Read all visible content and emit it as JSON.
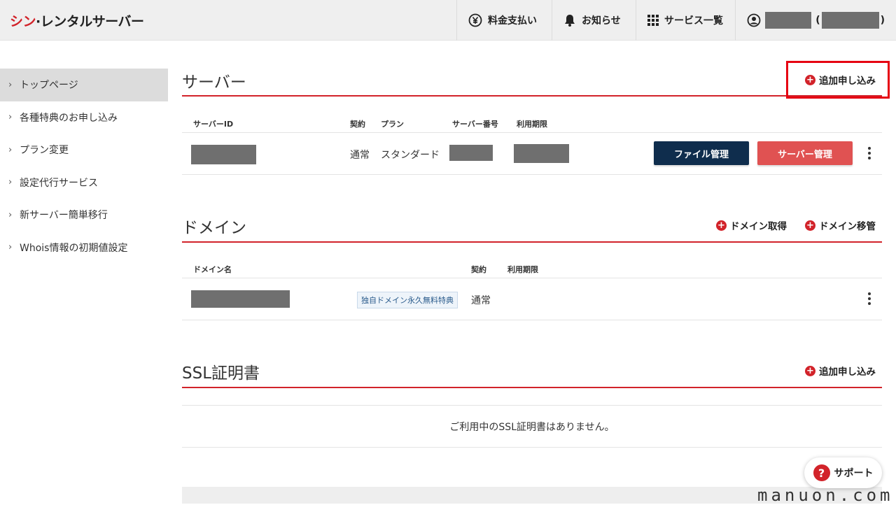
{
  "header": {
    "logo_accent": "シン",
    "logo_rest": "·レンタルサーバー",
    "nav": {
      "billing": "料金支払い",
      "notice": "お知らせ",
      "services": "サービス一覧",
      "user_open": "(",
      "user_close": ")"
    }
  },
  "sidebar": {
    "items": [
      {
        "label": "トップページ"
      },
      {
        "label": "各種特典のお申し込み"
      },
      {
        "label": "プラン変更"
      },
      {
        "label": "設定代行サービス"
      },
      {
        "label": "新サーバー簡単移行"
      },
      {
        "label": "Whois情報の初期値設定"
      }
    ]
  },
  "server": {
    "title": "サーバー",
    "add_label": "追加申し込み",
    "columns": {
      "id": "サーバーID",
      "contract": "契約",
      "plan": "プラン",
      "number": "サーバー番号",
      "expiry": "利用期限"
    },
    "row": {
      "contract": "通常",
      "plan": "スタンダード"
    },
    "file_button": "ファイル管理",
    "manage_button": "サーバー管理"
  },
  "domain": {
    "title": "ドメイン",
    "get_label": "ドメイン取得",
    "transfer_label": "ドメイン移管",
    "columns": {
      "name": "ドメイン名",
      "contract": "契約",
      "expiry": "利用期限"
    },
    "row": {
      "tag": "独自ドメイン永久無料特典",
      "contract": "通常"
    }
  },
  "ssl": {
    "title": "SSL証明書",
    "add_label": "追加申し込み",
    "empty": "ご利用中のSSL証明書はありません。"
  },
  "support": {
    "label": "サポート"
  },
  "watermark": "manuon.com",
  "colors": {
    "accent": "#d2232a",
    "file_button": "#0f2d4d",
    "manage_button": "#e05252",
    "highlight": "#e60012"
  }
}
